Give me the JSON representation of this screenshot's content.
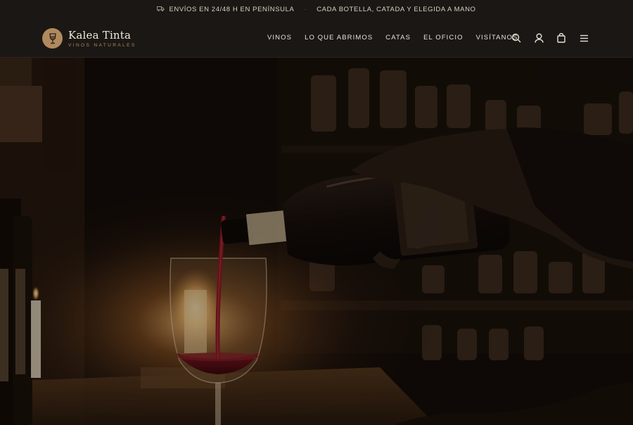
{
  "announcement": {
    "items": [
      "ENVÍOS EN 24/48 H EN PENÍNSULA",
      "CADA BOTELLA, CATADA Y ELEGIDA A MANO"
    ],
    "separator": "·"
  },
  "brand": {
    "name": "Kalea Tinta",
    "tagline": "VINOS NATURALES",
    "accent_color": "#b08a5e"
  },
  "nav": {
    "items": [
      "VINOS",
      "LO QUE ABRIMOS",
      "CATAS",
      "EL OFICIO",
      "VISÍTANOS"
    ]
  },
  "header_icons": [
    "search-icon",
    "account-icon",
    "cart-icon",
    "menu-icon"
  ],
  "hero": {
    "image": "wine-pouring-photo"
  }
}
